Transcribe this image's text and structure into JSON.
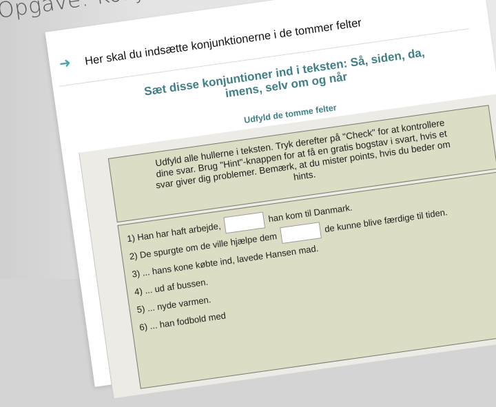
{
  "page": {
    "title": "Opgave: Konjunkt"
  },
  "instruction": {
    "arrow_icon": "arrow-right-icon",
    "text": "Her skal du indsætte konjunktionerne i de tommer felter"
  },
  "exercise": {
    "heading_line1": "Sæt disse konjuntioner ind i teksten: Så, siden, da,",
    "heading_line2": "imens, selv om og når",
    "subheading": "Udfyld de tomme felter",
    "intro_lines": [
      "Udfyld alle hullerne i teksten. Tryk derefter på \"Check\" for at kontrollere",
      "dine svar. Brug \"Hint\"-knappen for at få en gratis bogstav i svart, hvis et",
      "svar giver dig problemer. Bemærk, at du mister points, hvis du beder om",
      "hints."
    ],
    "questions": [
      {
        "before": "1) Han har haft arbejde,",
        "after": "han kom til Danmark."
      },
      {
        "before": "2) De spurgte om de ville hjælpe dem",
        "after": "de kunne blive færdige til tiden."
      },
      {
        "before": "3) ... hans kone købte ind, lavede Hansen mad.",
        "after": ""
      },
      {
        "before": "4) ... ud af bussen.",
        "after": ""
      },
      {
        "before": "5) ... nyde varmen.",
        "after": ""
      },
      {
        "before": "6) ... han fodbold med",
        "after": ""
      }
    ]
  }
}
